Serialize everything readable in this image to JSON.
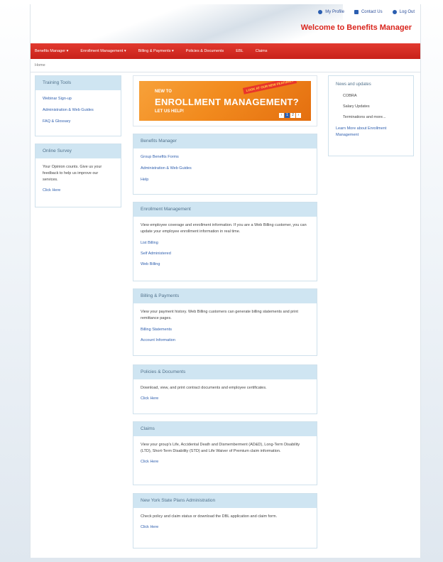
{
  "header": {
    "links": [
      {
        "label": "My Profile",
        "icon": "user-icon"
      },
      {
        "label": "Contact Us",
        "icon": "mail-icon"
      },
      {
        "label": "Log Out",
        "icon": "logout-icon"
      }
    ],
    "welcome": "Welcome to Benefits Manager"
  },
  "nav": {
    "items": [
      "Benefits Manager ▾",
      "Enrollment Management ▾",
      "Billing & Payments ▾",
      "Policies & Documents",
      "EBL",
      "Claims"
    ]
  },
  "breadcrumb": "Home",
  "training": {
    "title": "Training Tools",
    "links": [
      "Webinar Sign-up",
      "Administration & Web Guides",
      "FAQ & Glossary"
    ]
  },
  "survey": {
    "title": "Online Survey",
    "text": "Your Opinion counts. Give us your feedback to help us improve our services.",
    "link": "Click Here"
  },
  "banner": {
    "line1": "NEW TO",
    "line2": "ENROLLMENT MANAGEMENT?",
    "line3": "LET US HELP!",
    "tag": "LOOK AT OUR NEW FEATURES",
    "pager": [
      "‹",
      "1",
      "2",
      "›"
    ]
  },
  "benefits": {
    "title": "Benefits Manager",
    "links": [
      "Group Benefits Forms",
      "Administration & Web Guides",
      "Help"
    ]
  },
  "enrollment": {
    "title": "Enrollment Management",
    "text": "View employee coverage and enrollment information. If you are a Web Billing customer, you can update your employee enrollment information in real time.",
    "links": [
      "List Billing",
      "Self Administered",
      "Web Billing"
    ]
  },
  "billing": {
    "title": "Billing & Payments",
    "text": "View your payment history. Web Billing customers can generate billing statements and print remittance pages.",
    "links": [
      "Billing Statements",
      "Account Information"
    ]
  },
  "policies": {
    "title": "Policies & Documents",
    "text": "Download, view, and print contract documents and employee certificates.",
    "link": "Click Here"
  },
  "claims": {
    "title": "Claims",
    "text": "View your group's Life, Accidental Death and Dismemberment (AD&D), Long-Term Disability (LTD), Short-Term Disability (STD) and Life Waiver of Premium claim information.",
    "link": "Click Here"
  },
  "nys": {
    "title": "New York State Plans Administration",
    "text": "Check policy and claim status or download the DBL application and claim form.",
    "link": "Click Here"
  },
  "news": {
    "title": "News and updates",
    "items": [
      "COBRA",
      "Salary Updates",
      "Terminations and more..."
    ],
    "link": "Learn More about Enrollment Management"
  },
  "colors": {
    "accent_red": "#d9251d",
    "box_header": "#cfe5f2",
    "link_blue": "#2f5fae"
  }
}
